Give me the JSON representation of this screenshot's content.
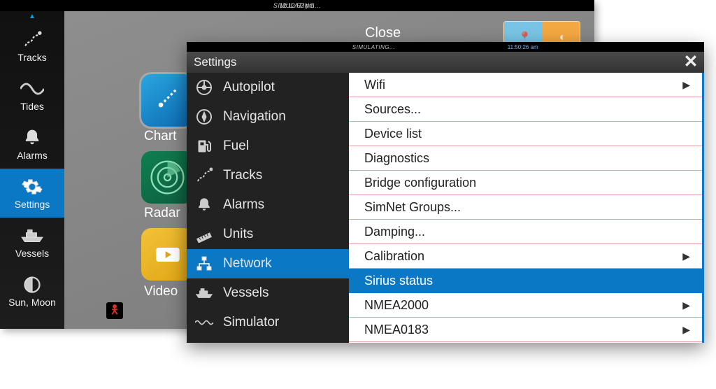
{
  "back": {
    "topbar": {
      "status": "SIMULATING...",
      "time": "12:12:52 pm"
    },
    "sidebar": {
      "items": [
        {
          "label": "Tracks"
        },
        {
          "label": "Tides"
        },
        {
          "label": "Alarms"
        },
        {
          "label": "Settings"
        },
        {
          "label": "Vessels"
        },
        {
          "label": "Sun, Moon"
        }
      ],
      "selected_index": 3
    },
    "close_label": "Close",
    "tiles": {
      "chart": "Chart",
      "radar": "Radar",
      "video": "Video"
    }
  },
  "front": {
    "topbar": {
      "status": "SIMULATING...",
      "time": "11:50:26 am"
    },
    "title": "Settings",
    "categories": [
      {
        "label": "Autopilot"
      },
      {
        "label": "Navigation"
      },
      {
        "label": "Fuel"
      },
      {
        "label": "Tracks"
      },
      {
        "label": "Alarms"
      },
      {
        "label": "Units"
      },
      {
        "label": "Network"
      },
      {
        "label": "Vessels"
      },
      {
        "label": "Simulator"
      }
    ],
    "category_selected_index": 6,
    "options": [
      {
        "label": "Wifi",
        "has_sub": true
      },
      {
        "label": "Sources...",
        "has_sub": false
      },
      {
        "label": "Device list",
        "has_sub": false
      },
      {
        "label": "Diagnostics",
        "has_sub": false
      },
      {
        "label": "Bridge configuration",
        "has_sub": false
      },
      {
        "label": "SimNet Groups...",
        "has_sub": false
      },
      {
        "label": "Damping...",
        "has_sub": false
      },
      {
        "label": "Calibration",
        "has_sub": true
      },
      {
        "label": "Sirius status",
        "has_sub": false
      },
      {
        "label": "NMEA2000",
        "has_sub": true
      },
      {
        "label": "NMEA0183",
        "has_sub": true
      }
    ],
    "option_selected_index": 8
  }
}
